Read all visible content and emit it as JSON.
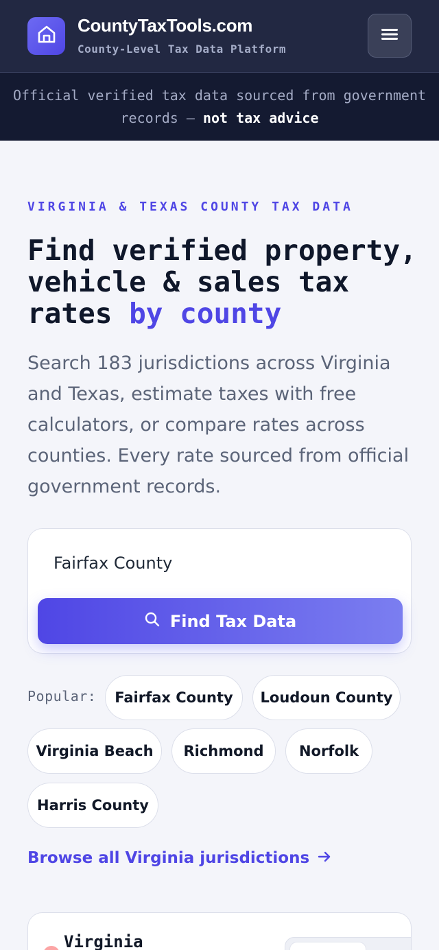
{
  "header": {
    "brand_name": "CountyTaxTools.com",
    "brand_tagline": "County-Level Tax Data Platform",
    "logo_icon": "building-icon",
    "menu_icon": "hamburger-menu-icon"
  },
  "notice": {
    "text": "Official verified tax data sourced from government records –",
    "emphasis": "not tax advice"
  },
  "hero": {
    "eyebrow": "VIRGINIA & TEXAS COUNTY TAX DATA",
    "headline_main": "Find verified property, vehicle & sales tax rates",
    "headline_accent": "by county",
    "description": "Search 183 jurisdictions across Virginia and Texas, estimate taxes with free calculators, or compare rates across counties. Every rate sourced from official government records."
  },
  "search": {
    "value": "Fairfax County",
    "button_label": "Find Tax Data",
    "button_icon": "search-icon"
  },
  "popular": {
    "label": "Popular:",
    "chips": [
      "Fairfax County",
      "Loudoun County",
      "Virginia Beach",
      "Richmond",
      "Norfolk",
      "Harris County"
    ]
  },
  "browse": {
    "label": "Browse all Virginia jurisdictions",
    "icon": "arrow-right-icon"
  },
  "peek_card": {
    "title": "Virginia"
  },
  "colors": {
    "accent": "#4f46e5",
    "header_bg": "#222842",
    "notice_bg": "#141a31",
    "page_bg": "#f4f5fa"
  }
}
